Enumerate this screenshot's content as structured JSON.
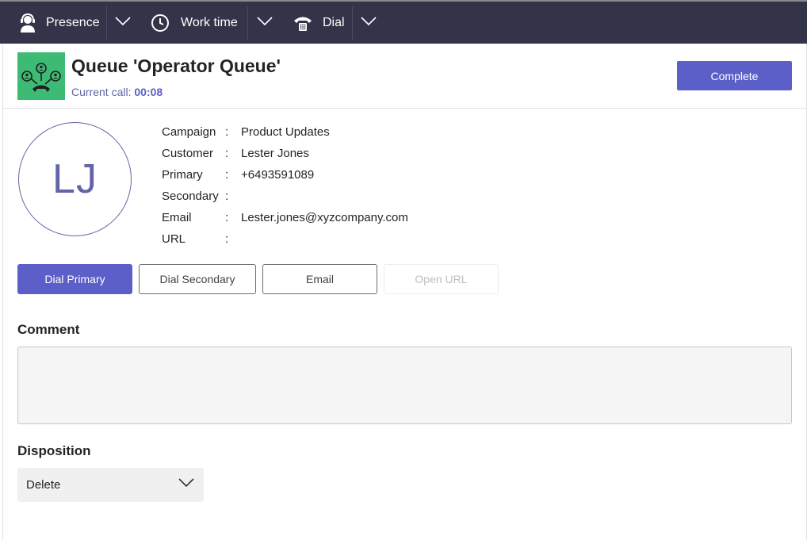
{
  "topbar": {
    "presence_label": "Presence",
    "worktime_label": "Work time",
    "dial_label": "Dial"
  },
  "header": {
    "queue_title": "Queue 'Operator Queue'",
    "current_call_label": "Current call:",
    "current_call_time": "00:08",
    "complete_label": "Complete"
  },
  "contact": {
    "initials": "LJ",
    "fields": [
      {
        "key": "Campaign",
        "value": "Product Updates"
      },
      {
        "key": "Customer",
        "value": "Lester Jones"
      },
      {
        "key": "Primary",
        "value": "+6493591089"
      },
      {
        "key": "Secondary",
        "value": ""
      },
      {
        "key": "Email",
        "value": "Lester.jones@xyzcompany.com"
      },
      {
        "key": "URL",
        "value": ""
      }
    ]
  },
  "actions": {
    "dial_primary": "Dial Primary",
    "dial_secondary": "Dial Secondary",
    "email": "Email",
    "open_url": "Open URL"
  },
  "comment": {
    "label": "Comment",
    "value": ""
  },
  "disposition": {
    "label": "Disposition",
    "selected": "Delete"
  },
  "colors": {
    "topbar_bg": "#33344a",
    "accent": "#5b5fc7",
    "queue_icon_bg": "#3dbb75"
  },
  "icons": [
    "headset-person-icon",
    "clock-icon",
    "telephone-icon",
    "chevron-down-icon",
    "queue-agents-icon"
  ]
}
